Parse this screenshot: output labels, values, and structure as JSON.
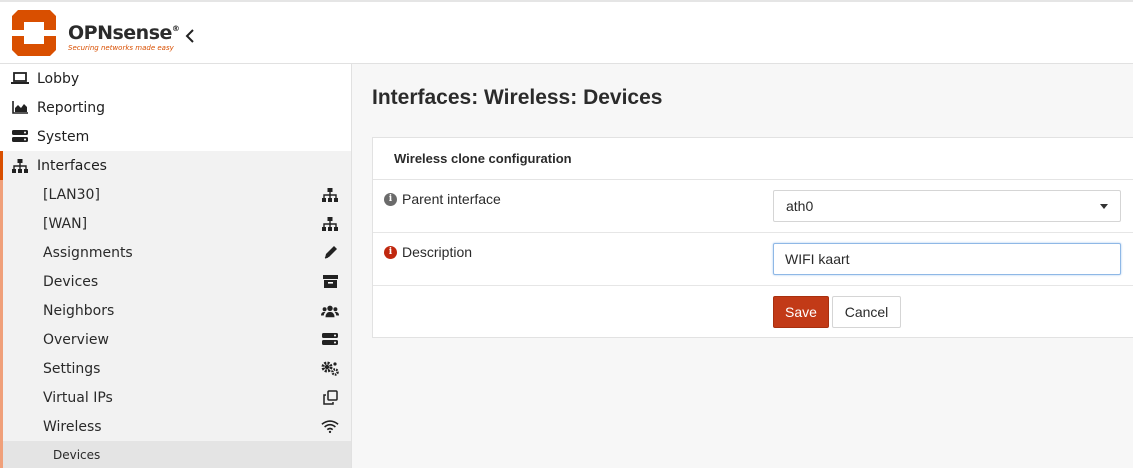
{
  "header": {
    "brand": "OPNsense",
    "brand_mark": "®",
    "tagline": "Securing networks made easy",
    "collapse_icon": "chevron-left-icon"
  },
  "sidebar": {
    "top_items": [
      {
        "label": "Lobby",
        "icon": "laptop-icon"
      },
      {
        "label": "Reporting",
        "icon": "area-chart-icon"
      },
      {
        "label": "System",
        "icon": "server-icon"
      }
    ],
    "active_group": {
      "label": "Interfaces",
      "icon": "sitemap-icon",
      "items": [
        {
          "label": "[LAN30]",
          "icon": "sitemap-icon"
        },
        {
          "label": "[WAN]",
          "icon": "sitemap-icon"
        },
        {
          "label": "Assignments",
          "icon": "pencil-icon"
        },
        {
          "label": "Devices",
          "icon": "archive-icon"
        },
        {
          "label": "Neighbors",
          "icon": "users-icon"
        },
        {
          "label": "Overview",
          "icon": "server-icon"
        },
        {
          "label": "Settings",
          "icon": "cogs-icon"
        },
        {
          "label": "Virtual IPs",
          "icon": "clone-icon"
        },
        {
          "label": "Wireless",
          "icon": "wifi-icon"
        }
      ],
      "sub_item": {
        "label": "Devices"
      }
    }
  },
  "main": {
    "title": "Interfaces: Wireless: Devices",
    "panel": {
      "heading": "Wireless clone configuration",
      "parent_interface": {
        "label": "Parent interface",
        "value": "ath0"
      },
      "description": {
        "label": "Description",
        "value": "WIFI kaart"
      },
      "save_label": "Save",
      "cancel_label": "Cancel"
    }
  },
  "colors": {
    "accent": "#d94f00",
    "save_button": "#c23a17",
    "required_info": "#c0280f"
  }
}
